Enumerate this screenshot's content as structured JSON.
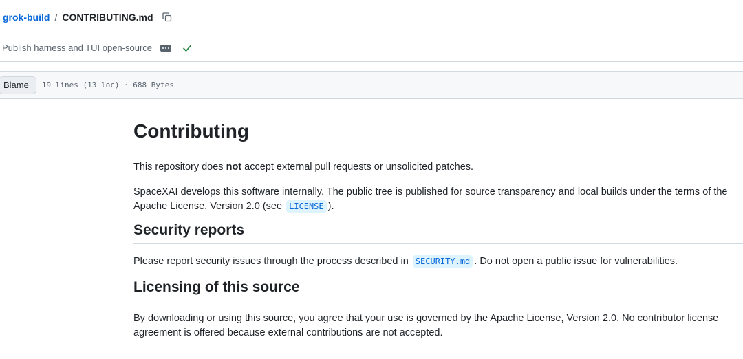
{
  "breadcrumb": {
    "repo": "grok-build",
    "separator": "/",
    "file": "CONTRIBUTING.md",
    "copy_icon": "copy-icon"
  },
  "commit": {
    "message": "Publish harness and TUI open-source",
    "ellipsis_icon": "ellipsis-icon",
    "status_icon": "check-icon",
    "status_color": "#1a7f37"
  },
  "toolbar": {
    "blame_label": "Blame",
    "file_info": "19 lines (13 loc) · 688 Bytes"
  },
  "content": {
    "title": "Contributing",
    "p1": {
      "before": "This repository does ",
      "strong": "not",
      "after": " accept external pull requests or unsolicited patches."
    },
    "p2": {
      "line1": "SpaceXAI develops this software internally. The public tree is published for source transparency and local builds under the terms of the",
      "line2_before": "Apache License, Version 2.0 (see ",
      "code": "LICENSE",
      "line2_after": ")."
    },
    "h_security": "Security reports",
    "p3": {
      "before": "Please report security issues through the process described in ",
      "code": "SECURITY.md",
      "after": ". Do not open a public issue for vulnerabilities."
    },
    "h_licensing": "Licensing of this source",
    "p4": {
      "line1": "By downloading or using this source, you agree that your use is governed by the Apache License, Version 2.0. No contributor license",
      "line2": "agreement is offered because external contributions are not accepted."
    }
  },
  "colors": {
    "link": "#0969da",
    "border": "#d1d9e0",
    "muted": "#59636e",
    "toolbar_bg": "#f6f8fa",
    "code_bg": "#ddf4ff"
  }
}
